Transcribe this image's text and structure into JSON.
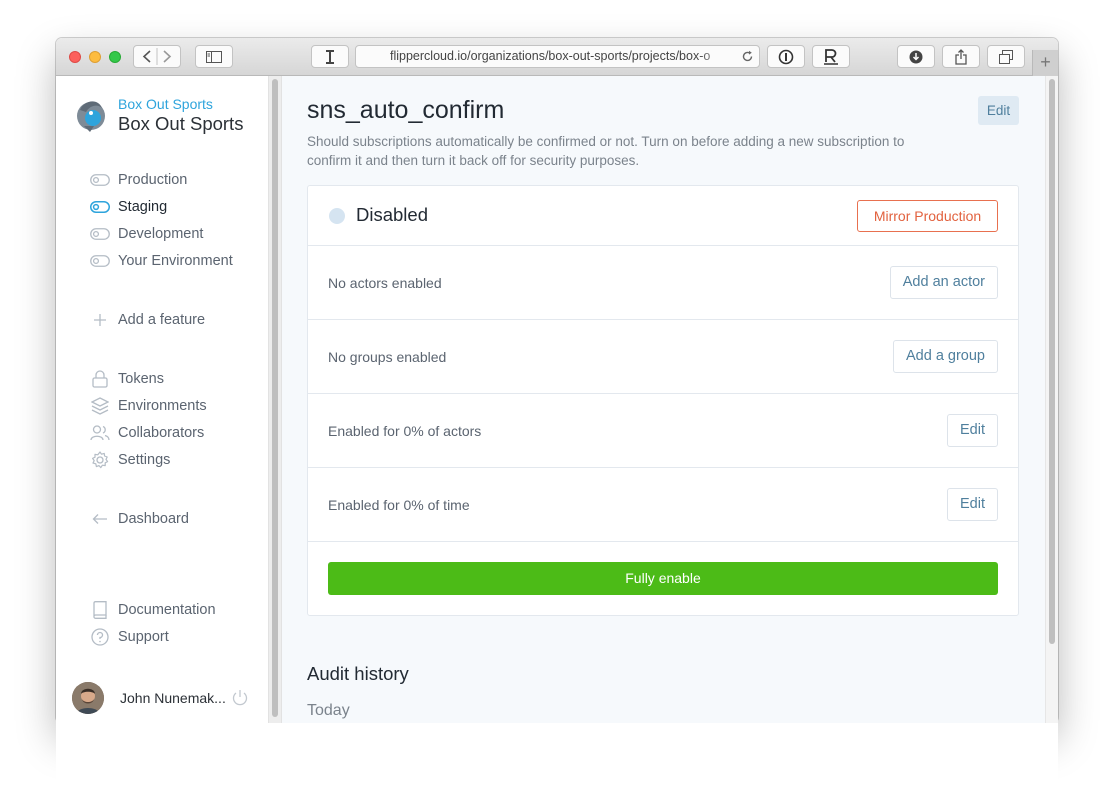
{
  "browser": {
    "url": "flippercloud.io/organizations/box-out-sports/projects/box-o"
  },
  "sidebar": {
    "org_small": "Box Out Sports",
    "org_big": "Box Out Sports",
    "environments": [
      {
        "label": "Production",
        "active": false
      },
      {
        "label": "Staging",
        "active": true
      },
      {
        "label": "Development",
        "active": false
      },
      {
        "label": "Your Environment",
        "active": false
      }
    ],
    "add_feature": "Add a feature",
    "settings_items": [
      "Tokens",
      "Environments",
      "Collaborators",
      "Settings"
    ],
    "dashboard": "Dashboard",
    "help_items": [
      "Documentation",
      "Support"
    ],
    "user_name": "John Nunemak..."
  },
  "feature": {
    "name": "sns_auto_confirm",
    "description": "Should subscriptions automatically be confirmed or not. Turn on before adding a new subscription to confirm it and then turn it back off for security purposes.",
    "edit_label": "Edit",
    "status": "Disabled",
    "mirror_label": "Mirror Production",
    "rows": [
      {
        "label": "No actors enabled",
        "button": "Add an actor"
      },
      {
        "label": "No groups enabled",
        "button": "Add a group"
      },
      {
        "label": "Enabled for 0% of actors",
        "button": "Edit"
      },
      {
        "label": "Enabled for 0% of time",
        "button": "Edit"
      }
    ],
    "enable_label": "Fully enable"
  },
  "audit": {
    "title": "Audit history",
    "today": "Today"
  },
  "colors": {
    "accent": "#2ea4dc",
    "enable_green": "#4cbb17",
    "mirror_orange": "#e2623f",
    "link_blue": "#4f7f9d"
  }
}
